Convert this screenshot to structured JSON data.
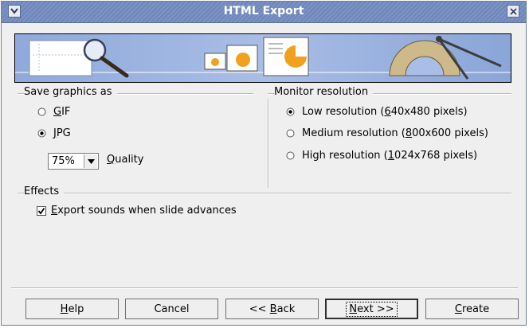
{
  "window": {
    "title": "HTML Export"
  },
  "graphics": {
    "group_label": "Save graphics as",
    "options": [
      {
        "key": "G",
        "rest": "IF",
        "selected": false
      },
      {
        "key": "J",
        "rest": "PG",
        "selected": true
      }
    ],
    "quality_value": "75%",
    "quality_label_key": "Q",
    "quality_label_rest": "uality"
  },
  "monitor": {
    "group_label": "Monitor resolution",
    "options": [
      {
        "pre": "Low resolution (",
        "key": "6",
        "post": "40x480 pixels)",
        "selected": true
      },
      {
        "pre": "Medium resolution (",
        "key": "8",
        "post": "00x600 pixels)",
        "selected": false
      },
      {
        "pre": "High resolution (",
        "key": "1",
        "post": "024x768 pixels)",
        "selected": false
      }
    ]
  },
  "effects": {
    "group_label": "Effects",
    "export_sounds_key": "E",
    "export_sounds_rest": "xport sounds when slide advances",
    "export_sounds_checked": true
  },
  "buttons": {
    "help_key": "H",
    "help_rest": "elp",
    "cancel": "Cancel",
    "back_pre": "<< ",
    "back_key": "B",
    "back_rest": "ack",
    "next_pre": "",
    "next_key": "N",
    "next_rest": "ext >>",
    "create_key": "C",
    "create_rest": "reate"
  }
}
